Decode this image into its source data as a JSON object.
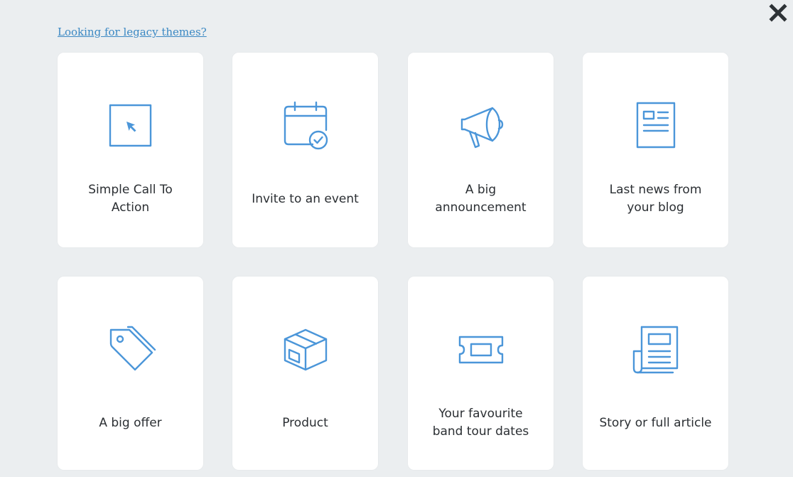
{
  "header": {
    "legacy_link": "Looking for legacy themes?"
  },
  "close": {
    "icon": "close-icon",
    "glyph": "✕"
  },
  "theme_color": "#4b96d9",
  "cards": [
    {
      "label": "Simple Call To Action",
      "icon": "cursor-in-box-icon"
    },
    {
      "label": "Invite to an event",
      "icon": "calendar-check-icon"
    },
    {
      "label": "A big announcement",
      "icon": "megaphone-icon"
    },
    {
      "label": "Last news from your blog",
      "icon": "document-icon"
    },
    {
      "label": "A big offer",
      "icon": "price-tag-icon"
    },
    {
      "label": "Product",
      "icon": "box-icon"
    },
    {
      "label": "Your favourite band tour dates",
      "icon": "ticket-icon"
    },
    {
      "label": "Story or full article",
      "icon": "newspaper-icon"
    }
  ]
}
